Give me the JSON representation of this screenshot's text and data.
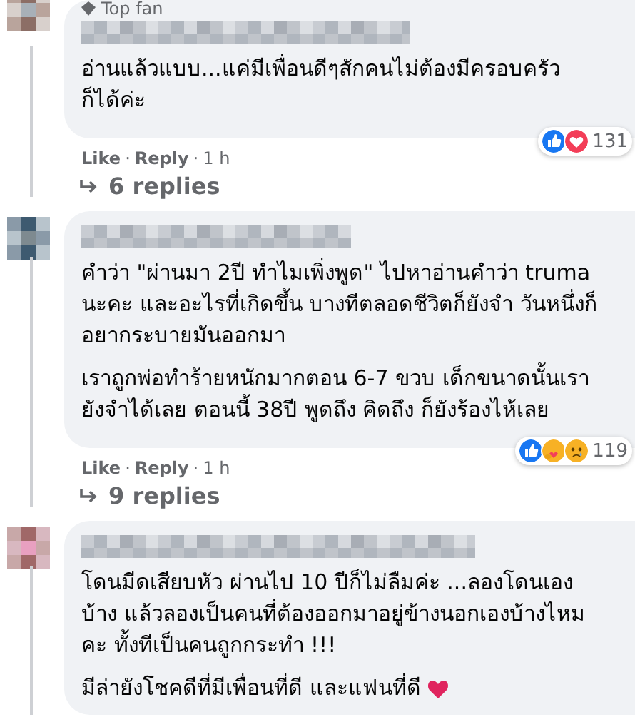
{
  "comments": [
    {
      "badge": "Top fan",
      "paragraphs": [
        "อ่านแล้วแบบ...แค่มีเพื่อนดีๆสักคนไม่ต้องมีครอบครัวก็ได้ค่ะ"
      ],
      "reactions": [
        {
          "kind": "like"
        },
        {
          "kind": "love"
        }
      ],
      "reaction_count": "131",
      "actions": [
        "Like",
        "Reply"
      ],
      "separator": "·",
      "time": "1 h",
      "replies": "6 replies"
    },
    {
      "paragraphs": [
        "คำว่า \"ผ่านมา 2ปี ทำไมเพิ่งพูด\" ไปหาอ่านคำว่า truma นะคะ และอะไรที่เกิดขึ้น บางทีตลอดชีวิตก็ยังจำ วันหนึ่งก็อยากระบายมันออกมา",
        "เราถูกพ่อทำร้ายหนักมากตอน 6-7 ขวบ เด็กขนาดนั้นเรายังจำได้เลย ตอนนี้ 38ปี พูดถึง คิดถึง ก็ยังร้องไห้เลย"
      ],
      "reactions": [
        {
          "kind": "like"
        },
        {
          "kind": "care"
        },
        {
          "kind": "sad"
        }
      ],
      "reaction_count": "119",
      "actions": [
        "Like",
        "Reply"
      ],
      "separator": "·",
      "time": "1 h",
      "replies": "9 replies"
    },
    {
      "paragraphs": [
        "โดนมีดเสียบหัว ผ่านไป 10 ปีก็ไม่ลืมค่ะ ...ลองโดนเองบ้าง แล้วลองเป็นคนที่ต้องออกมาอยู่ข้างนอกเองบ้างไหมคะ ทั้งทีเป็นคนถูกกระทำ !!!",
        "มีล่ายังโชคดีที่มีเพื่อนที่ดี และแฟนที่ดี"
      ],
      "ends_with_heart": true
    }
  ]
}
